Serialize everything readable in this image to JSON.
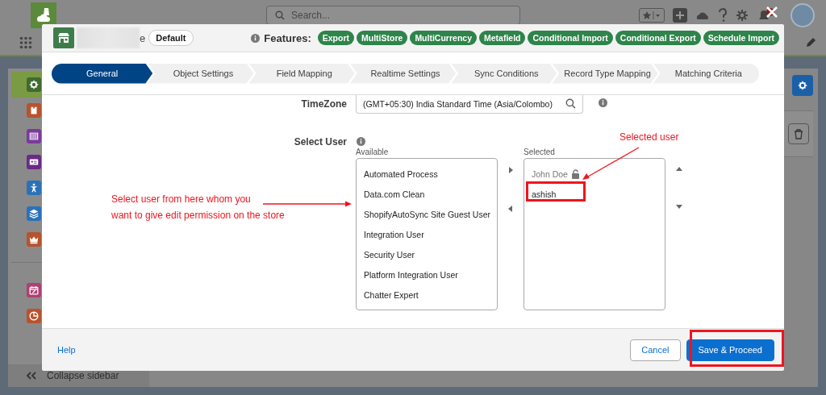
{
  "app_header": {
    "search": {
      "placeholder": "Search..."
    }
  },
  "app_sidebar": {
    "groups": [
      [
        {
          "kind": "gear",
          "color": "#3f6b2e",
          "selected": true
        },
        {
          "kind": "chip",
          "color": "#b8532c",
          "selected": false
        },
        {
          "kind": "barcode",
          "color": "#7a3a9a",
          "selected": false
        },
        {
          "kind": "card",
          "color": "#6a2a86",
          "selected": false
        },
        {
          "kind": "person",
          "color": "#2a72b8",
          "selected": false
        },
        {
          "kind": "layers",
          "color": "#2a72b8",
          "selected": false
        },
        {
          "kind": "crown",
          "color": "#b8532c",
          "selected": false
        }
      ],
      [
        {
          "kind": "calendar",
          "color": "#b03f72",
          "selected": false
        },
        {
          "kind": "pie",
          "color": "#b8532c",
          "selected": false
        }
      ]
    ],
    "collapse_label": "Collapse sidebar"
  },
  "modal": {
    "store_name_tail": "e",
    "store_badge": "Default",
    "features_label": "Features:",
    "features": [
      "Export",
      "MultiStore",
      "MultiCurrency",
      "Metafield",
      "Conditional Import",
      "Conditional Export",
      "Schedule Import"
    ],
    "steps": [
      {
        "label": "General",
        "selected": true
      },
      {
        "label": "Object Settings",
        "selected": false
      },
      {
        "label": "Field Mapping",
        "selected": false
      },
      {
        "label": "Realtime Settings",
        "selected": false
      },
      {
        "label": "Sync Conditions",
        "selected": false
      },
      {
        "label": "Record Type Mapping",
        "selected": false
      },
      {
        "label": "Matching Criteria",
        "selected": false
      }
    ],
    "timezone": {
      "label": "TimeZone",
      "value": "(GMT+05:30) India Standard Time (Asia/Colombo)"
    },
    "select_user": {
      "label": "Select User",
      "available_label": "Available",
      "available": [
        "Automated Process",
        "Data.com Clean",
        "ShopifyAutoSync Site Guest User",
        "Integration User",
        "Security User",
        "Platform Integration User",
        "Chatter Expert"
      ],
      "selected_label": "Selected",
      "selected": [
        {
          "name": "John Doe",
          "locked": true
        },
        {
          "name": "ashish",
          "locked": false
        }
      ]
    },
    "footer": {
      "help": "Help",
      "buttons": [
        {
          "label": "Cancel",
          "kind": "neutral"
        },
        {
          "label": "Save & Proceed",
          "kind": "brand"
        }
      ]
    }
  },
  "annotations": {
    "available_note": "Select user from here whom you\nwant to give edit permission on the store",
    "selected_note": "Selected user"
  }
}
